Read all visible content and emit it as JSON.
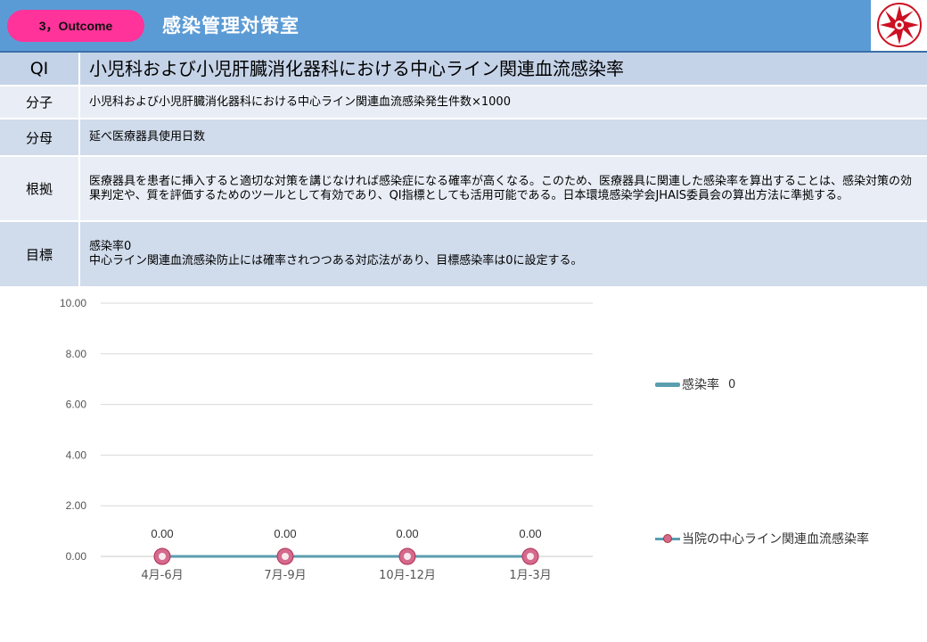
{
  "header": {
    "badge": "3，Outcome",
    "department": "感染管理対策室",
    "bar_color": "#5b9bd5",
    "badge_color": "#ff3399",
    "logo_icon": "hospital-emblem"
  },
  "info": {
    "qi": {
      "label": "QI",
      "value": "小児科および小児肝臓消化器科における中心ライン関連血流感染率"
    },
    "numerator": {
      "label": "分子",
      "value": "小児科および小児肝臓消化器科における中心ライン関連血流感染発生件数×1000"
    },
    "denominator": {
      "label": "分母",
      "value": "延べ医療器具使用日数"
    },
    "rationale": {
      "label": "根拠",
      "value": "医療器具を患者に挿入すると適切な対策を講じなければ感染症になる確率が高くなる。このため、医療器具に関連した感染率を算出することは、感染対策の効果判定や、質を評価するためのツールとして有効であり、QI指標としても活用可能である。日本環境感染学会JHAIS委員会の算出方法に準拠する。"
    },
    "target": {
      "label": "目標",
      "line1": "感染率0",
      "line2": "中心ライン関連血流感染防止には確率されつつある対応法があり、目標感染率は0に設定する。"
    }
  },
  "chart_data": {
    "type": "line",
    "categories": [
      "4月-6月",
      "7月-9月",
      "10月-12月",
      "1月-3月"
    ],
    "series": [
      {
        "name": "感染率",
        "values": [
          0,
          0,
          0,
          0
        ],
        "color": "#5b9eb0",
        "legend_value": "0"
      },
      {
        "name": "当院の中心ライン関連血流感染率",
        "values": [
          0,
          0,
          0,
          0
        ],
        "color": "#5b9eb0",
        "marker_color": "#d46a8e"
      }
    ],
    "data_labels": [
      "0.00",
      "0.00",
      "0.00",
      "0.00"
    ],
    "yticks": [
      "0.00",
      "2.00",
      "4.00",
      "6.00",
      "8.00",
      "10.00"
    ],
    "ylim": [
      0,
      10
    ],
    "grid": true,
    "legend_position": "right"
  }
}
